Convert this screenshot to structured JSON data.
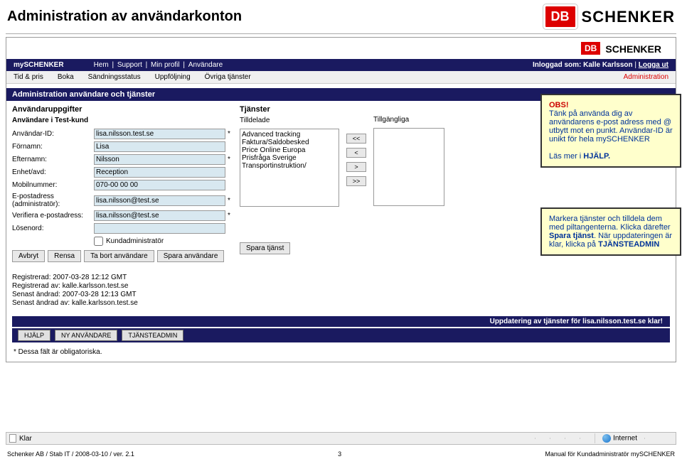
{
  "page_title": "Administration av användarkonton",
  "brand": {
    "logo": "DB",
    "name": "SCHENKER",
    "portal": "mySCHENKER"
  },
  "topnav": {
    "links": [
      "Hem",
      "Support",
      "Min profil",
      "Användare"
    ],
    "logged_in_prefix": "Inloggad som:",
    "user": "Kalle Karlsson",
    "logout": "Logga ut"
  },
  "subnav": {
    "items": [
      "Tid & pris",
      "Boka",
      "Sändningsstatus",
      "Uppföljning",
      "Övriga tjänster"
    ],
    "admin": "Administration"
  },
  "section_title": "Administration användare och tjänster",
  "left": {
    "group": "Användaruppgifter",
    "subhead": "Användare i Test-kund",
    "fields": {
      "user_id_l": "Användar-ID:",
      "user_id": "lisa.nilsson.test.se",
      "first_l": "Förnamn:",
      "first": "Lisa",
      "last_l": "Efternamn:",
      "last": "Nilsson",
      "dept_l": "Enhet/avd:",
      "dept": "Reception",
      "mobile_l": "Mobilnummer:",
      "mobile": "070-00 00 00",
      "email_l": "E-postadress (administratör):",
      "email": "lisa.nilsson@test.se",
      "verify_l": "Verifiera e-postadress:",
      "verify": "lisa.nilsson@test.se",
      "pass_l": "Lösenord:",
      "pass": "",
      "chk_l": "Kundadministratör"
    },
    "buttons": {
      "cancel": "Avbryt",
      "clear": "Rensa",
      "remove": "Ta bort användare",
      "save": "Spara användare"
    },
    "reg": {
      "r1l": "Registrerad:",
      "r1": "2007-03-28 12:12 GMT",
      "r2l": "Registrerad av:",
      "r2": "kalle.karlsson.test.se",
      "r3l": "Senast ändrad:",
      "r3": "2007-03-28 12:13 GMT",
      "r4l": "Senast ändrad av:",
      "r4": "kalle.karlsson.test.se"
    }
  },
  "mid": {
    "group": "Tjänster",
    "assigned_l": "Tilldelade",
    "assigned": [
      "Advanced tracking",
      "Faktura/Saldobesked",
      "Price Online Europa",
      "Prisfråga Sverige",
      "Transportinstruktion/"
    ],
    "spara": "Spara tjänst"
  },
  "ctrl": {
    "all_l": "<<",
    "one_l": "<",
    "one_r": ">",
    "all_r": ">>"
  },
  "right": {
    "avail_l": "Tillgängliga"
  },
  "callout1": {
    "obs": "OBS!",
    "t1": "Tänk på använda dig av användarens e-post adress med @ utbytt mot en punkt. Användar-ID är unikt för hela mySCHENKER",
    "t2a": "Läs mer i ",
    "t2b": "HJÄLP."
  },
  "callout2": {
    "t1": "Markera tjänster och tilldela dem med piltangenterna. Klicka därefter ",
    "b1": "Spara tjänst",
    "t2": ". När uppdateringen är klar, klicka på ",
    "b2": "TJÄNSTEADMIN"
  },
  "status_bar": "Uppdatering av tjänster för lisa.nilsson.test.se klar!",
  "bottom_buttons": [
    "HJÄLP",
    "NY ANVÄNDARE",
    "TJÄNSTEADMIN"
  ],
  "oblig": "* Dessa fält är obligatoriska.",
  "ie": {
    "done": "Klar",
    "zone": "Internet"
  },
  "footer": {
    "left": "Schenker AB / Stab IT / 2008-03-10 / ver. 2.1",
    "center": "3",
    "right": "Manual för Kundadministratör mySCHENKER"
  }
}
